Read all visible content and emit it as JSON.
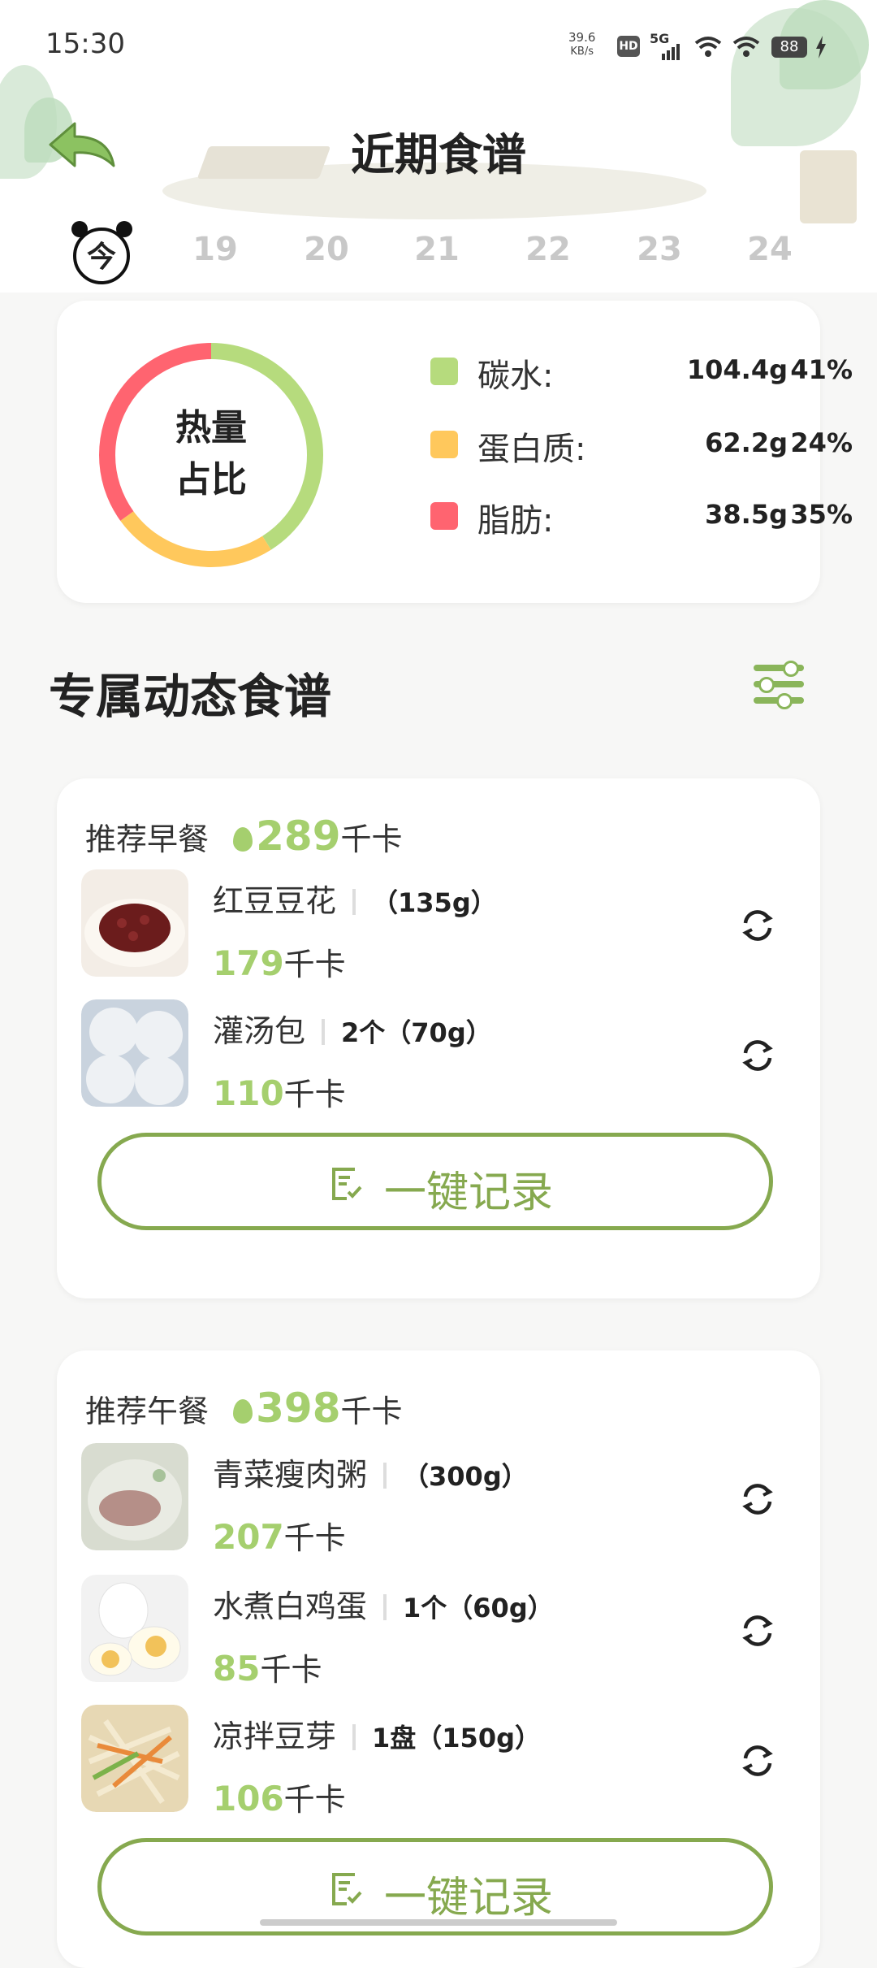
{
  "status_bar": {
    "time": "15:30",
    "net_speed_value": "39.6",
    "net_speed_unit": "KB/s",
    "hd_badge": "HD",
    "network": "5G",
    "battery": "88"
  },
  "header": {
    "title": "近期食谱",
    "today_label": "今",
    "dates": [
      "19",
      "20",
      "21",
      "22",
      "23",
      "24"
    ]
  },
  "nutrition": {
    "donut_label_line1": "热量",
    "donut_label_line2": "占比",
    "items": [
      {
        "name": "碳水:",
        "value": "104.4g",
        "percent": "41%",
        "color": "#b6db7d",
        "fraction": 0.41
      },
      {
        "name": "蛋白质:",
        "value": "62.2g",
        "percent": "24%",
        "color": "#ffc85c",
        "fraction": 0.24
      },
      {
        "name": "脂肪:",
        "value": "38.5g",
        "percent": "35%",
        "color": "#ff6470",
        "fraction": 0.35
      }
    ]
  },
  "section": {
    "title": "专属动态食谱",
    "filter_icon": "sliders-icon"
  },
  "meals": [
    {
      "label": "推荐早餐",
      "calories": "289",
      "unit": "千卡",
      "button_label": "一键记录",
      "foods": [
        {
          "name": "红豆豆花",
          "portion": "（135g）",
          "calories": "179",
          "unit": "千卡"
        },
        {
          "name": "灌汤包",
          "portion": "2个（70g）",
          "calories": "110",
          "unit": "千卡"
        }
      ]
    },
    {
      "label": "推荐午餐",
      "calories": "398",
      "unit": "千卡",
      "button_label": "一键记录",
      "foods": [
        {
          "name": "青菜瘦肉粥",
          "portion": "（300g）",
          "calories": "207",
          "unit": "千卡"
        },
        {
          "name": "水煮白鸡蛋",
          "portion": "1个（60g）",
          "calories": "85",
          "unit": "千卡"
        },
        {
          "name": "凉拌豆芽",
          "portion": "1盘（150g）",
          "calories": "106",
          "unit": "千卡"
        }
      ]
    }
  ],
  "colors": {
    "accent_green": "#a5cf6e",
    "button_green": "#86a94f"
  }
}
